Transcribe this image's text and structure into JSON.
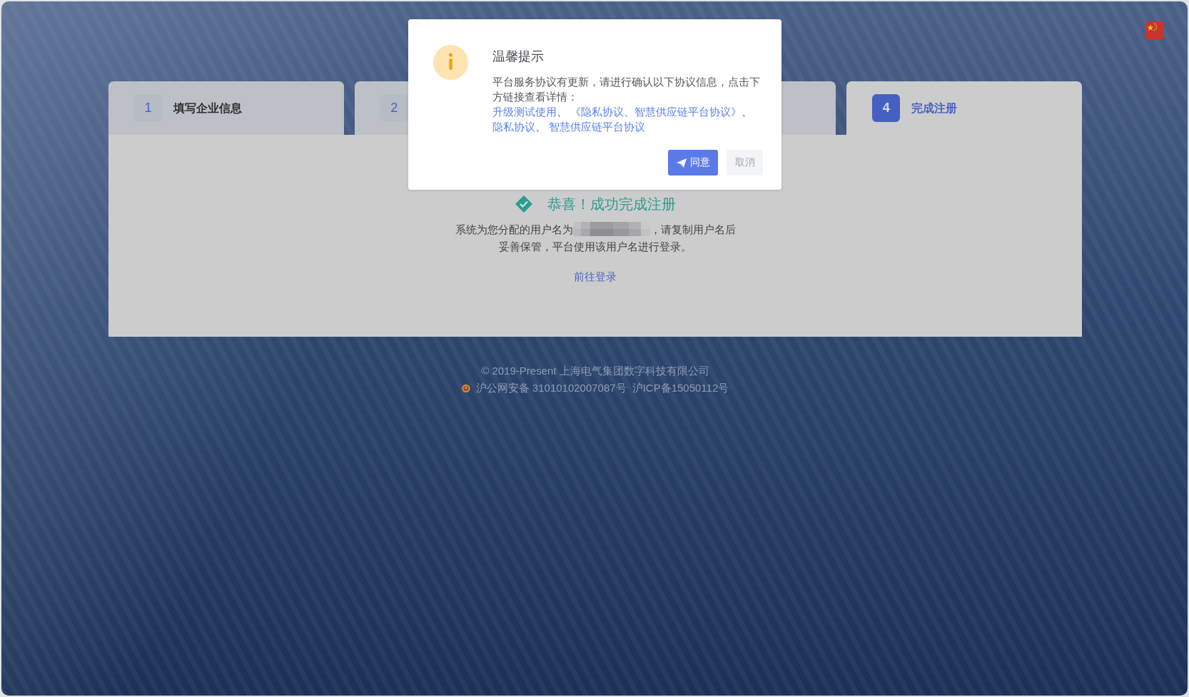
{
  "steps": [
    {
      "number": "1",
      "label": "填写企业信息",
      "selected": false
    },
    {
      "number": "2",
      "selected": false
    },
    {
      "selected": false
    },
    {
      "number": "4",
      "label": "完成注册",
      "selected": true
    }
  ],
  "result": {
    "title": "恭喜！成功完成注册",
    "message_before": "系统为您分配的用户名为",
    "username_redacted": true,
    "message_after": "，请复制用户名后妥善保管，平台使用该用户名进行登录。",
    "link": "前往登录"
  },
  "footer": {
    "copyright": "© 2019-Present 上海电气集团数字科技有限公司",
    "records": [
      "沪公网安备 31010102007087号",
      "沪ICP备15050112号"
    ]
  },
  "dialog": {
    "title": "温馨提示",
    "message": "平台服务协议有更新，请进行确认以下协议信息，点击下方链接查看详情：",
    "links": [
      {
        "text": "升级测试使用",
        "suffix": "、"
      },
      {
        "text": "《隐私协议、智慧供应链平台协议》",
        "suffix": "、"
      },
      {
        "text": "隐私协议",
        "suffix": "、"
      },
      {
        "text": "智慧供应链平台协议"
      }
    ],
    "buttons": [
      {
        "label": "同意",
        "kind": "primary"
      },
      {
        "label": "取消",
        "kind": "default"
      }
    ]
  }
}
